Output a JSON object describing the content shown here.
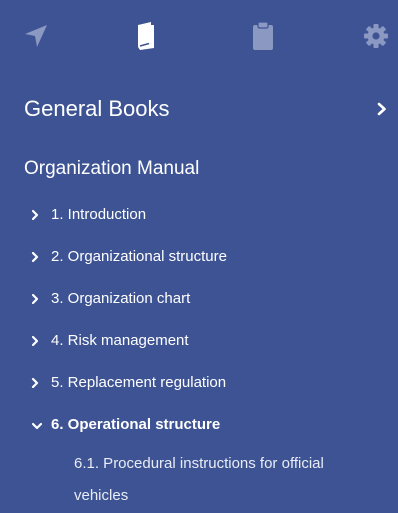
{
  "toolbar": {
    "buttons": [
      {
        "name": "navigation-icon",
        "active": false
      },
      {
        "name": "book-icon",
        "active": true
      },
      {
        "name": "clipboard-icon",
        "active": false
      },
      {
        "name": "gear-icon",
        "active": false
      }
    ],
    "active_color": "#ffffff",
    "inactive_color": "#8a98c2"
  },
  "books": {
    "title": "General Books",
    "chevron_icon": "chevron-right-icon"
  },
  "manual": {
    "title": "Organization Manual"
  },
  "toc": {
    "items": [
      {
        "label": "1. Introduction",
        "expanded": false
      },
      {
        "label": "2. Organizational structure",
        "expanded": false
      },
      {
        "label": "3. Organization chart",
        "expanded": false
      },
      {
        "label": "4. Risk management",
        "expanded": false
      },
      {
        "label": "5. Replacement regulation",
        "expanded": false
      },
      {
        "label": "6. Operational structure",
        "expanded": true
      }
    ],
    "sub_items": [
      {
        "label": "6.1. Procedural instructions for official vehicles"
      }
    ]
  },
  "colors": {
    "background": "#3d5393",
    "text": "#ffffff"
  }
}
